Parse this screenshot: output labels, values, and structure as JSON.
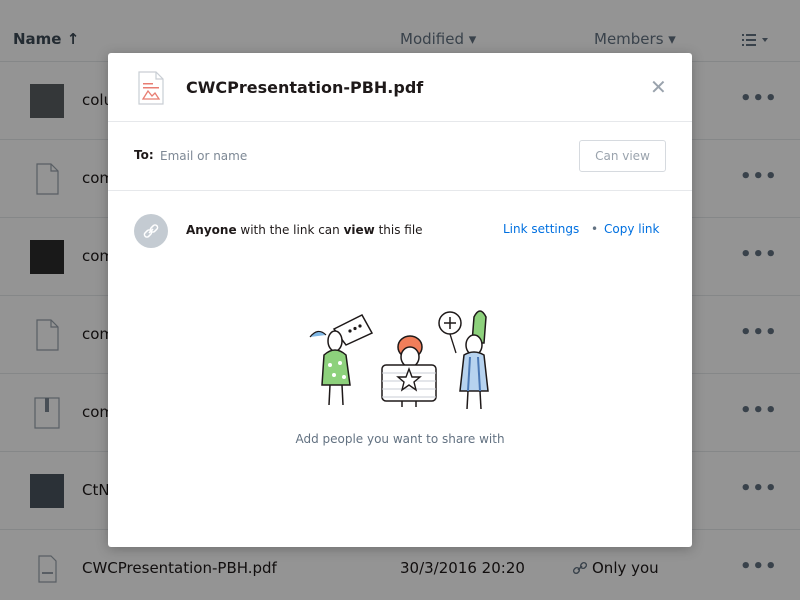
{
  "list_header": {
    "name": "Name ↑",
    "modified": "Modified ▾",
    "members": "Members ▾",
    "view_icon": "list-view-icon"
  },
  "rows": [
    {
      "name": "colu",
      "thumb": "image"
    },
    {
      "name": "com",
      "thumb": "doc"
    },
    {
      "name": "com",
      "thumb": "image-dark"
    },
    {
      "name": "com",
      "thumb": "doc"
    },
    {
      "name": "com",
      "thumb": "zip"
    },
    {
      "name": "CtN",
      "thumb": "image"
    },
    {
      "name": "CWCPresentation-PBH.pdf",
      "modified": "30/3/2016 20:20",
      "members": "Only you",
      "thumb": "pdf"
    }
  ],
  "more_label": "•••",
  "modal": {
    "file_title": "CWCPresentation-PBH.pdf",
    "close_label": "✕",
    "to_label": "To:",
    "to_placeholder": "Email or name",
    "can_view": "Can view",
    "link_prefix": "Anyone",
    "link_middle": " with the link can ",
    "link_view": "view",
    "link_suffix": " this file",
    "link_settings": "Link settings",
    "link_sep": "•",
    "copy_link": "Copy link",
    "add_people": "Add people you want to share with"
  },
  "colors": {
    "accent": "#0070e0",
    "overlay": "rgba(0,0,0,0.42)"
  }
}
